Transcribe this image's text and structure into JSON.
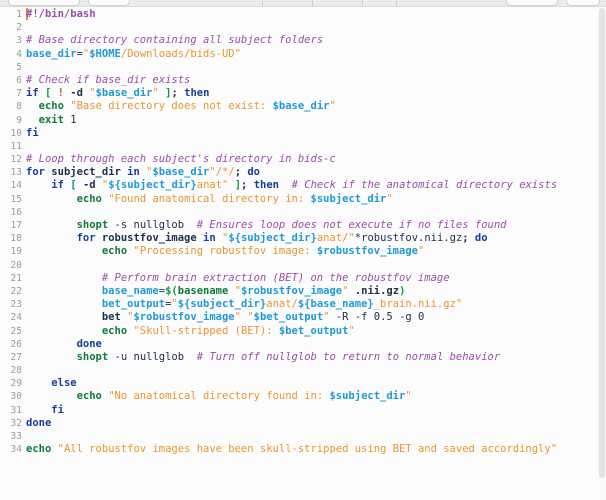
{
  "app": {
    "kind": "code-editor",
    "language": "bash",
    "background_color": "#fcfcfc",
    "gutter_color": "#9a9a9a",
    "caret_color": "#e8883a"
  },
  "toolbar": {
    "visible_fragment": "cut-off row of rounded toolbar buttons",
    "buttons": [
      "",
      "",
      "",
      "",
      ""
    ]
  },
  "palette": {
    "comment": "#9a4ea8",
    "keyword": "#1a3c9c",
    "builtin": "#0f7a3d",
    "string": "#e8962c",
    "variable": "#1e9ad6",
    "plain": "#20314f",
    "bracket": "#0f9a4a",
    "operator": "#d14b2a"
  },
  "editor": {
    "first_line": 1,
    "last_line": 34,
    "total_lines": 34,
    "lines": [
      {
        "n": 1,
        "text": "#!/bin/bash"
      },
      {
        "n": 2,
        "text": ""
      },
      {
        "n": 3,
        "text": "# Base directory containing all subject folders"
      },
      {
        "n": 4,
        "text": "base_dir=\"$HOME/Downloads/bids-UD\""
      },
      {
        "n": 5,
        "text": ""
      },
      {
        "n": 6,
        "text": "# Check if base_dir exists"
      },
      {
        "n": 7,
        "text": "if [ ! -d \"$base_dir\" ]; then"
      },
      {
        "n": 8,
        "text": "  echo \"Base directory does not exist: $base_dir\""
      },
      {
        "n": 9,
        "text": "  exit 1"
      },
      {
        "n": 10,
        "text": "fi"
      },
      {
        "n": 11,
        "text": ""
      },
      {
        "n": 12,
        "text": "# Loop through each subject's directory in bids-c"
      },
      {
        "n": 13,
        "text": "for subject_dir in \"$base_dir\"/*/; do"
      },
      {
        "n": 14,
        "text": "    if [ -d \"${subject_dir}anat\" ]; then  # Check if the anatomical directory exists"
      },
      {
        "n": 15,
        "text": "        echo \"Found anatomical directory in: $subject_dir\""
      },
      {
        "n": 16,
        "text": ""
      },
      {
        "n": 17,
        "text": "        shopt -s nullglob  # Ensures loop does not execute if no files found"
      },
      {
        "n": 18,
        "text": "        for robustfov_image in \"${subject_dir}anat/\"*robustfov.nii.gz; do"
      },
      {
        "n": 19,
        "text": "            echo \"Processing robustfov image: $robustfov_image\""
      },
      {
        "n": 20,
        "text": ""
      },
      {
        "n": 21,
        "text": "            # Perform brain extraction (BET) on the robustfov image"
      },
      {
        "n": 22,
        "text": "            base_name=$(basename \"$robustfov_image\" .nii.gz)"
      },
      {
        "n": 23,
        "text": "            bet_output=\"${subject_dir}anat/${base_name}_brain.nii.gz\""
      },
      {
        "n": 24,
        "text": "            bet \"$robustfov_image\" \"$bet_output\" -R -f 0.5 -g 0"
      },
      {
        "n": 25,
        "text": "            echo \"Skull-stripped (BET): $bet_output\""
      },
      {
        "n": 26,
        "text": "        done"
      },
      {
        "n": 27,
        "text": "        shopt -u nullglob  # Turn off nullglob to return to normal behavior"
      },
      {
        "n": 28,
        "text": ""
      },
      {
        "n": 29,
        "text": "    else"
      },
      {
        "n": 30,
        "text": "        echo \"No anatomical directory found in: $subject_dir\""
      },
      {
        "n": 31,
        "text": "    fi"
      },
      {
        "n": 32,
        "text": "done"
      },
      {
        "n": 33,
        "text": ""
      },
      {
        "n": 34,
        "text": "echo \"All robustfov images have been skull-stripped using BET and saved accordingly\""
      }
    ]
  },
  "scrollbar": {
    "orientation": "vertical",
    "thumb_position_percent": 0
  }
}
